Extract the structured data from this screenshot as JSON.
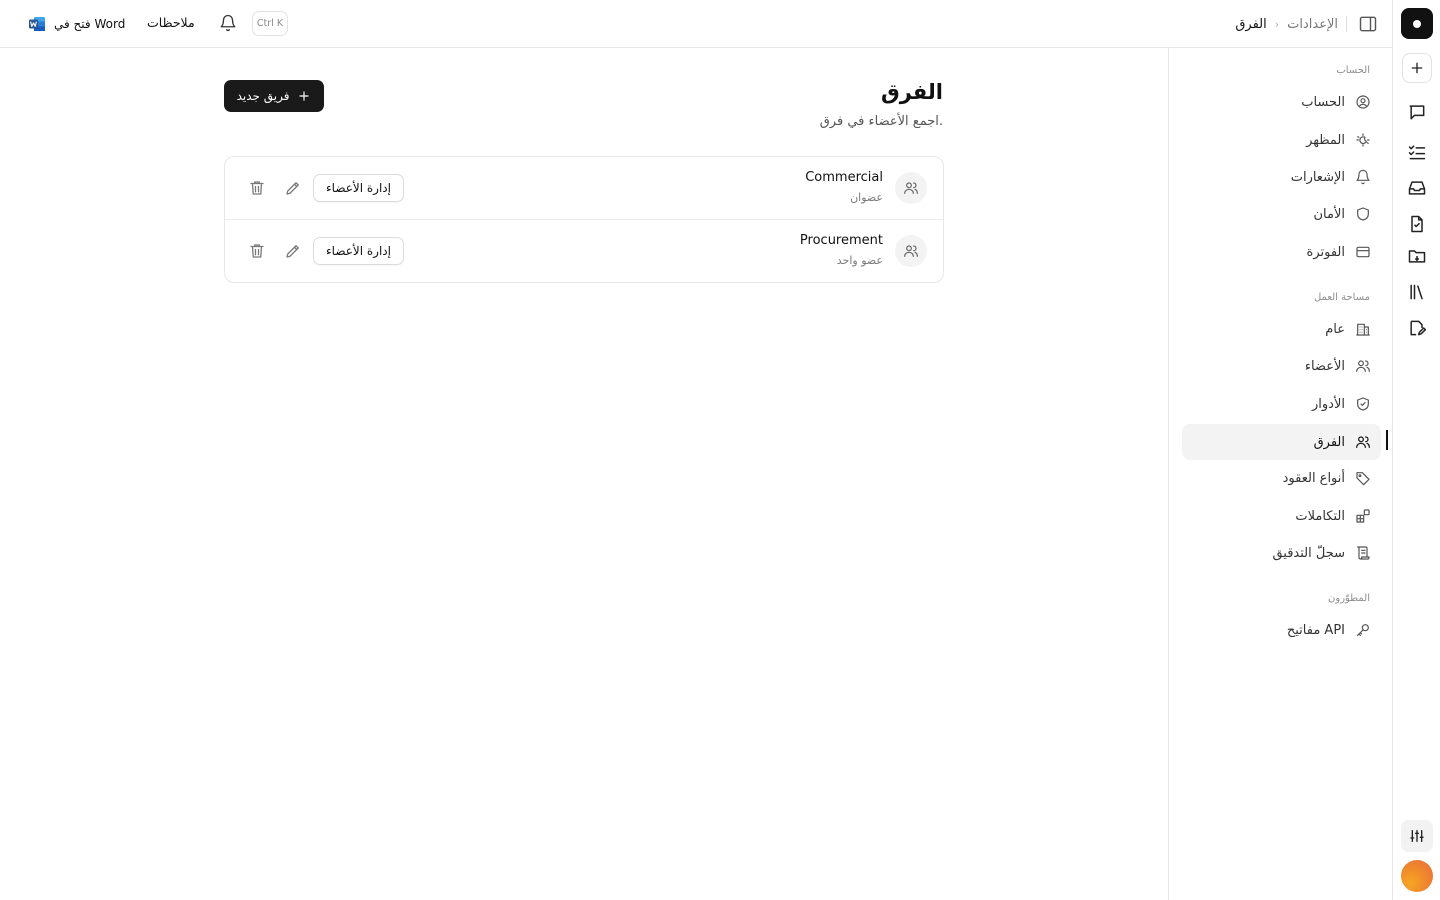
{
  "header": {
    "breadcrumb_root": "الإعدادات",
    "breadcrumb_sep": "›",
    "breadcrumb_current": "الفرق",
    "open_in_word": "فتح في Word",
    "notes": "ملاحظات",
    "shortcut": "Ctrl K"
  },
  "rail": {
    "items": [
      "new-icon",
      "chat-icon",
      "checklist-icon",
      "inbox-icon",
      "document-icon",
      "folder-icon",
      "library-icon",
      "edit-note-icon",
      "sliders-icon"
    ]
  },
  "nav": {
    "sections": [
      {
        "title": "الحساب",
        "items": [
          {
            "label": "الحساب",
            "icon": "user-circle-icon"
          },
          {
            "label": "المظهر",
            "icon": "appearance-icon"
          },
          {
            "label": "الإشعارات",
            "icon": "bell-icon"
          },
          {
            "label": "الأمان",
            "icon": "shield-icon"
          },
          {
            "label": "الفوترة",
            "icon": "credit-card-icon"
          }
        ]
      },
      {
        "title": "مساحة العمل",
        "items": [
          {
            "label": "عام",
            "icon": "building-icon"
          },
          {
            "label": "الأعضاء",
            "icon": "users-icon"
          },
          {
            "label": "الأدوار",
            "icon": "shield-check-icon"
          },
          {
            "label": "الفرق",
            "icon": "team-icon",
            "active": true
          },
          {
            "label": "أنواع العقود",
            "icon": "tag-icon"
          },
          {
            "label": "التكاملات",
            "icon": "blocks-icon"
          },
          {
            "label": "سجلّ التدقيق",
            "icon": "scroll-icon"
          }
        ]
      },
      {
        "title": "المطوّرون",
        "items": [
          {
            "label": "مفاتيح API",
            "icon": "key-icon"
          }
        ]
      }
    ]
  },
  "main": {
    "title": "الفرق",
    "subtitle": "اجمع الأعضاء في فرق.",
    "new_team_label": "فريق جديد",
    "teams": [
      {
        "name": "Commercial",
        "members": "عضوان",
        "manage_label": "إدارة الأعضاء"
      },
      {
        "name": "Procurement",
        "members": "عضو واحد",
        "manage_label": "إدارة الأعضاء"
      }
    ]
  },
  "colors": {
    "accent": "#111111",
    "border": "#e7e7e7",
    "muted_text": "#777777",
    "active_nav_bg": "#f3f3f3",
    "word_blue": "#2b579a"
  }
}
